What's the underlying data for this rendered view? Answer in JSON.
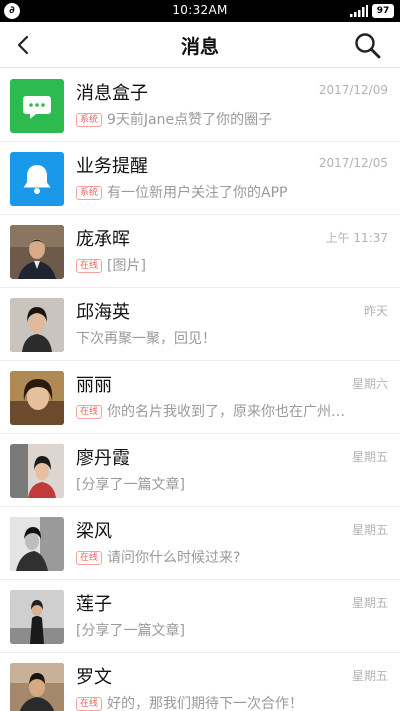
{
  "status_bar": {
    "app_icon_glyph": "∂",
    "time": "10:32AM",
    "battery": "97"
  },
  "header": {
    "title": "消息"
  },
  "messages": [
    {
      "name": "消息盒子",
      "time": "2017/12/09",
      "tag": "系统",
      "preview": "9天前Jane点赞了你的圈子",
      "avatar": "chat-bubble-icon"
    },
    {
      "name": "业务提醒",
      "time": "2017/12/05",
      "tag": "系统",
      "preview": "有一位新用户关注了你的APP",
      "avatar": "bell-icon"
    },
    {
      "name": "庞承晖",
      "time": "上午 11:37",
      "tag": "在线",
      "preview": "[图片]",
      "avatar": "photo"
    },
    {
      "name": "邱海英",
      "time": "昨天",
      "tag": "",
      "preview": "下次再聚一聚，回见！",
      "avatar": "photo"
    },
    {
      "name": "丽丽",
      "time": "星期六",
      "tag": "在线",
      "preview": "你的名片我收到了，原来你也在广州…",
      "avatar": "photo"
    },
    {
      "name": "廖丹霞",
      "time": "星期五",
      "tag": "",
      "preview": "[分享了一篇文章]",
      "avatar": "photo"
    },
    {
      "name": "梁风",
      "time": "星期五",
      "tag": "在线",
      "preview": "请问你什么时候过来?",
      "avatar": "photo"
    },
    {
      "name": "莲子",
      "time": "星期五",
      "tag": "",
      "preview": "[分享了一篇文章]",
      "avatar": "photo"
    },
    {
      "name": "罗文",
      "time": "星期五",
      "tag": "在线",
      "preview": "好的，那我们期待下一次合作！",
      "avatar": "photo"
    }
  ],
  "colors": {
    "inbox_green": "#2dbb4f",
    "reminder_blue": "#1a99e8",
    "tag_red": "#f06060"
  }
}
